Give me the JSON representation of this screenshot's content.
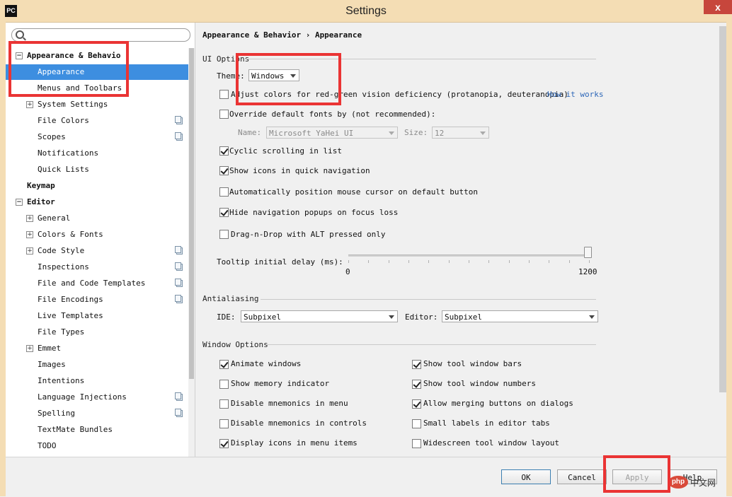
{
  "window": {
    "title": "Settings",
    "logo": "PC",
    "close_glyph": "x",
    "accent_color": "#3d8ee0",
    "annotation_color": "#ea3434"
  },
  "sidebar": {
    "search": {
      "value": "",
      "icon": "search-icon"
    },
    "items": [
      {
        "label": "Appearance & Behavio",
        "expander": "−",
        "bold": true
      },
      {
        "label": "Appearance",
        "selected": true
      },
      {
        "label": "Menus and Toolbars"
      },
      {
        "label": "System Settings",
        "expander": "+"
      },
      {
        "label": "File Colors",
        "project": true
      },
      {
        "label": "Scopes",
        "project": true
      },
      {
        "label": "Notifications"
      },
      {
        "label": "Quick Lists"
      },
      {
        "label": "Keymap",
        "bold": true
      },
      {
        "label": "Editor",
        "expander": "−",
        "bold": true
      },
      {
        "label": "General",
        "expander": "+"
      },
      {
        "label": "Colors & Fonts",
        "expander": "+"
      },
      {
        "label": "Code Style",
        "expander": "+",
        "project": true
      },
      {
        "label": "Inspections",
        "project": true
      },
      {
        "label": "File and Code Templates",
        "project": true
      },
      {
        "label": "File Encodings",
        "project": true
      },
      {
        "label": "Live Templates"
      },
      {
        "label": "File Types"
      },
      {
        "label": "Emmet",
        "expander": "+"
      },
      {
        "label": "Images"
      },
      {
        "label": "Intentions"
      },
      {
        "label": "Language Injections",
        "project": true
      },
      {
        "label": "Spelling",
        "project": true
      },
      {
        "label": "TextMate Bundles"
      },
      {
        "label": "TODO"
      }
    ]
  },
  "main": {
    "breadcrumb": "Appearance & Behavior › Appearance",
    "ui_options": {
      "section": "UI Options",
      "theme_label": "Theme:",
      "theme_value": "Windows",
      "adjust_colors": {
        "label": "Adjust colors for red-green vision deficiency (protanopia, deuteranopia)",
        "checked": false
      },
      "how_it_works": "How it works",
      "override_fonts": {
        "label": "Override default fonts by (not recommended):",
        "checked": false
      },
      "font_name_label": "Name:",
      "font_name_value": "Microsoft YaHei UI",
      "font_size_label": "Size:",
      "font_size_value": "12",
      "cyclic_scrolling": {
        "label": "Cyclic scrolling in list",
        "checked": true
      },
      "show_icons": {
        "label": "Show icons in quick navigation",
        "checked": true
      },
      "auto_position": {
        "label": "Automatically position mouse cursor on default button",
        "checked": false
      },
      "hide_nav_popups": {
        "label": "Hide navigation popups on focus loss",
        "checked": true
      },
      "drag_n_drop": {
        "label": "Drag-n-Drop with ALT pressed only",
        "checked": false
      },
      "tooltip_label": "Tooltip initial delay (ms):",
      "tooltip_min": "0",
      "tooltip_max": "1200",
      "tooltip_value_fraction": 1.0
    },
    "antialiasing": {
      "section": "Antialiasing",
      "ide_label": "IDE:",
      "ide_value": "Subpixel",
      "editor_label": "Editor:",
      "editor_value": "Subpixel"
    },
    "window_options": {
      "section": "Window Options",
      "animate_windows": {
        "label": "Animate windows",
        "checked": true
      },
      "show_memory": {
        "label": "Show memory indicator",
        "checked": false
      },
      "disable_mnemonics_menu": {
        "label": "Disable mnemonics in menu",
        "checked": false
      },
      "disable_mnemonics_controls": {
        "label": "Disable mnemonics in controls",
        "checked": false
      },
      "display_icons_menu": {
        "label": "Display icons in menu items",
        "checked": true
      },
      "show_tool_window_bars": {
        "label": "Show tool window bars",
        "checked": true
      },
      "show_tool_window_numbers": {
        "label": "Show tool window numbers",
        "checked": true
      },
      "allow_merging": {
        "label": "Allow merging buttons on dialogs",
        "checked": true
      },
      "small_labels": {
        "label": "Small labels in editor tabs",
        "checked": false
      },
      "widescreen": {
        "label": "Widescreen tool window layout",
        "checked": false
      }
    }
  },
  "footer": {
    "ok": "OK",
    "cancel": "Cancel",
    "apply": "Apply",
    "help": "Help"
  },
  "watermark": {
    "logo": "php",
    "text": "中文网"
  }
}
